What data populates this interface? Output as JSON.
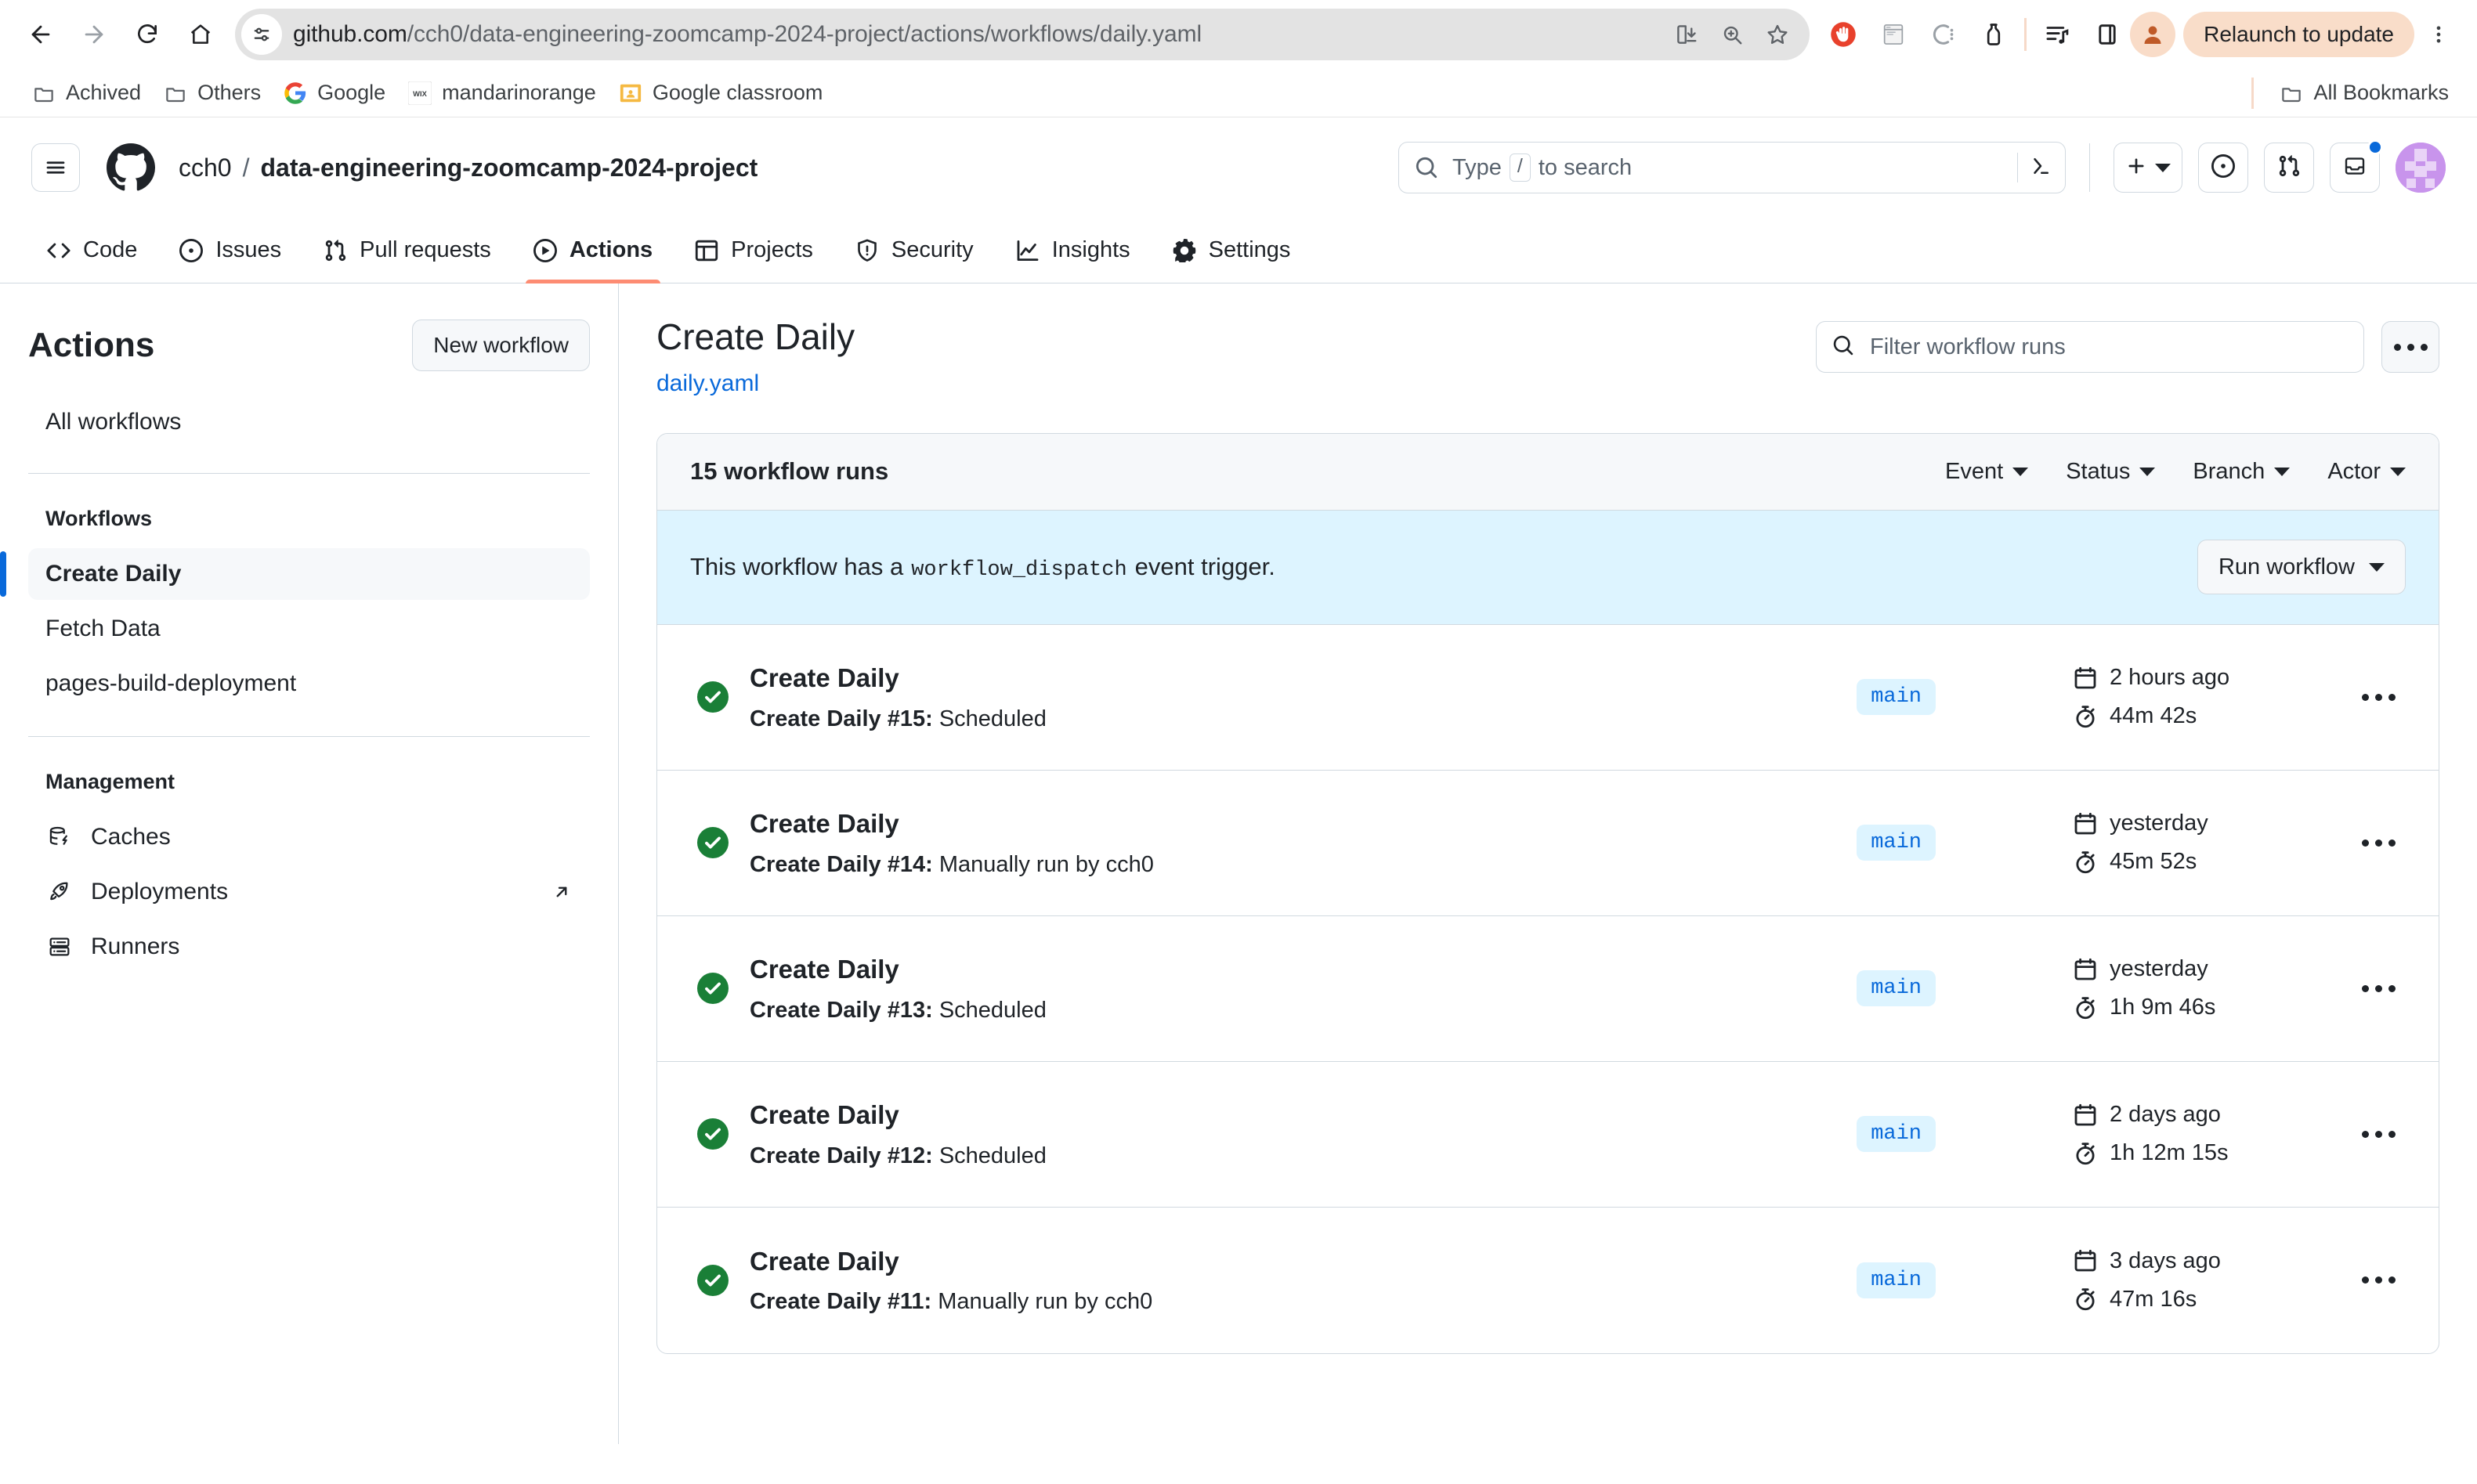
{
  "browser": {
    "nav": {
      "back_icon": "arrow-left-icon",
      "forward_icon": "arrow-right-icon",
      "reload_icon": "reload-icon",
      "home_icon": "home-icon"
    },
    "omnibox": {
      "site_info_icon": "site-settings-icon",
      "url_host": "github.com",
      "url_path": "/cch0/data-engineering-zoomcamp-2024-project/actions/workflows/daily.yaml",
      "install_icon": "install-app-icon",
      "zoom_icon": "zoom-icon",
      "bookmark_icon": "star-icon"
    },
    "extensions": [
      {
        "name": "adblock-extension-icon",
        "label": "AdBlock"
      },
      {
        "name": "window-extension-icon",
        "label": "Window"
      },
      {
        "name": "circle-extension-icon",
        "label": "Circle"
      },
      {
        "name": "bottle-extension-icon",
        "label": "Bottle"
      }
    ],
    "right_actions": [
      {
        "name": "reading-list-icon",
        "label": "Reading list"
      },
      {
        "name": "side-panel-icon",
        "label": "Side panel"
      }
    ],
    "profile_icon": "profile-avatar-icon",
    "relaunch_label": "Relaunch to update",
    "menu_icon": "chrome-menu-icon",
    "bookmarks": [
      {
        "label": "Achived",
        "icon": "folder-icon"
      },
      {
        "label": "Others",
        "icon": "folder-icon"
      },
      {
        "label": "Google",
        "icon": "google-icon"
      },
      {
        "label": "mandarinorange",
        "icon": "wix-icon"
      },
      {
        "label": "Google classroom",
        "icon": "google-classroom-icon"
      }
    ],
    "all_bookmarks_label": "All Bookmarks",
    "all_bookmarks_icon": "folder-icon"
  },
  "gh_header": {
    "hamburger_icon": "hamburger-menu-icon",
    "logo_icon": "github-mark-icon",
    "owner": "cch0",
    "separator": "/",
    "repo": "data-engineering-zoomcamp-2024-project",
    "search": {
      "icon": "search-icon",
      "placeholder_before": "Type",
      "placeholder_key": "/",
      "placeholder_after": "to search",
      "terminal_icon": "command-palette-icon"
    },
    "actions": [
      {
        "name": "create-new-button",
        "icon": "plus-icon",
        "has_caret": true
      },
      {
        "name": "issues-button",
        "icon": "issue-opened-icon",
        "has_caret": false
      },
      {
        "name": "pull-requests-button",
        "icon": "git-pull-request-icon",
        "has_caret": false
      },
      {
        "name": "notifications-button",
        "icon": "inbox-icon",
        "has_caret": false,
        "badge": true
      }
    ],
    "avatar_name": "user-avatar"
  },
  "gh_nav": {
    "tabs": [
      {
        "label": "Code",
        "icon": "code-icon",
        "active": false
      },
      {
        "label": "Issues",
        "icon": "issue-opened-icon",
        "active": false
      },
      {
        "label": "Pull requests",
        "icon": "git-pull-request-icon",
        "active": false
      },
      {
        "label": "Actions",
        "icon": "play-icon",
        "active": true
      },
      {
        "label": "Projects",
        "icon": "table-icon",
        "active": false
      },
      {
        "label": "Security",
        "icon": "shield-icon",
        "active": false
      },
      {
        "label": "Insights",
        "icon": "graph-icon",
        "active": false
      },
      {
        "label": "Settings",
        "icon": "gear-icon",
        "active": false
      }
    ],
    "active_underline_color": "#fd8c73"
  },
  "sidebar": {
    "title": "Actions",
    "new_workflow_label": "New workflow",
    "all_workflows_label": "All workflows",
    "workflows_heading": "Workflows",
    "workflows": [
      {
        "label": "Create Daily",
        "selected": true
      },
      {
        "label": "Fetch Data",
        "selected": false
      },
      {
        "label": "pages-build-deployment",
        "selected": false
      }
    ],
    "management_heading": "Management",
    "management": [
      {
        "label": "Caches",
        "icon": "database-icon",
        "external": false
      },
      {
        "label": "Deployments",
        "icon": "rocket-icon",
        "external": true
      },
      {
        "label": "Runners",
        "icon": "server-icon",
        "external": false
      }
    ],
    "selected_accent": "#0969da"
  },
  "main": {
    "title": "Create Daily",
    "file_link": "daily.yaml",
    "filter": {
      "icon": "search-icon",
      "placeholder": "Filter workflow runs",
      "value": ""
    },
    "more_button_icon": "kebab-horizontal-icon",
    "runs_count_label": "15 workflow runs",
    "filters": [
      {
        "label": "Event"
      },
      {
        "label": "Status"
      },
      {
        "label": "Branch"
      },
      {
        "label": "Actor"
      }
    ],
    "dispatch_banner": {
      "text_before": "This workflow has a",
      "code": "workflow_dispatch",
      "text_after": "event trigger.",
      "button_label": "Run workflow",
      "background": "#ddf4ff"
    },
    "runs": [
      {
        "status": "success",
        "status_icon": "check-circle-fill-icon",
        "title": "Create Daily",
        "desc_prefix": "Create Daily #15:",
        "desc_suffix": "Scheduled",
        "branch": "main",
        "date_icon": "calendar-icon",
        "date": "2 hours ago",
        "duration_icon": "stopwatch-icon",
        "duration": "44m 42s"
      },
      {
        "status": "success",
        "status_icon": "check-circle-fill-icon",
        "title": "Create Daily",
        "desc_prefix": "Create Daily #14:",
        "desc_suffix": "Manually run by cch0",
        "branch": "main",
        "date_icon": "calendar-icon",
        "date": "yesterday",
        "duration_icon": "stopwatch-icon",
        "duration": "45m 52s"
      },
      {
        "status": "success",
        "status_icon": "check-circle-fill-icon",
        "title": "Create Daily",
        "desc_prefix": "Create Daily #13:",
        "desc_suffix": "Scheduled",
        "branch": "main",
        "date_icon": "calendar-icon",
        "date": "yesterday",
        "duration_icon": "stopwatch-icon",
        "duration": "1h 9m 46s"
      },
      {
        "status": "success",
        "status_icon": "check-circle-fill-icon",
        "title": "Create Daily",
        "desc_prefix": "Create Daily #12:",
        "desc_suffix": "Scheduled",
        "branch": "main",
        "date_icon": "calendar-icon",
        "date": "2 days ago",
        "duration_icon": "stopwatch-icon",
        "duration": "1h 12m 15s"
      },
      {
        "status": "success",
        "status_icon": "check-circle-fill-icon",
        "title": "Create Daily",
        "desc_prefix": "Create Daily #11:",
        "desc_suffix": "Manually run by cch0",
        "branch": "main",
        "date_icon": "calendar-icon",
        "date": "3 days ago",
        "duration_icon": "stopwatch-icon",
        "duration": "47m 16s"
      }
    ],
    "colors": {
      "success_green": "#1a7f37",
      "link_blue": "#0969da",
      "badge_bg": "#ddf4ff",
      "panel_border": "#d1d9e0",
      "header_bg": "#f6f8fa"
    }
  }
}
